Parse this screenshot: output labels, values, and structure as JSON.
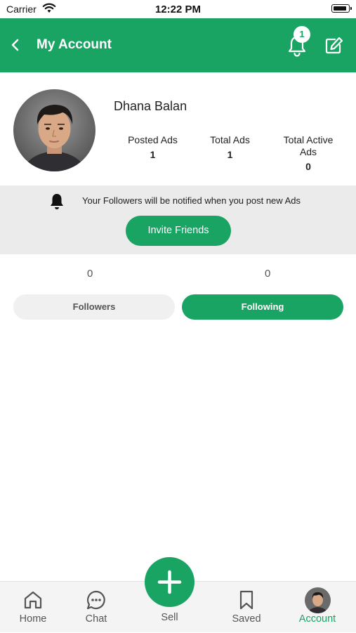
{
  "status_bar": {
    "carrier": "Carrier",
    "time": "12:22 PM"
  },
  "header": {
    "title": "My Account",
    "notification_count": "1"
  },
  "profile": {
    "name": "Dhana Balan",
    "stats": [
      {
        "label": "Posted Ads",
        "value": "1"
      },
      {
        "label": "Total Ads",
        "value": "1"
      },
      {
        "label": "Total Active Ads",
        "value": "0"
      }
    ]
  },
  "notice": {
    "text": "Your Followers will be notified when you post new Ads",
    "invite_label": "Invite Friends"
  },
  "follow": {
    "followers_count": "0",
    "following_count": "0",
    "followers_label": "Followers",
    "following_label": "Following",
    "active_tab": "Following"
  },
  "bottom_nav": {
    "home": "Home",
    "chat": "Chat",
    "sell": "Sell",
    "saved": "Saved",
    "account": "Account",
    "active": "Account"
  },
  "colors": {
    "primary": "#1aa463",
    "band": "#ebebeb",
    "inactive_tab": "#f0f0f0",
    "nav_bg": "#f4f4f4"
  }
}
